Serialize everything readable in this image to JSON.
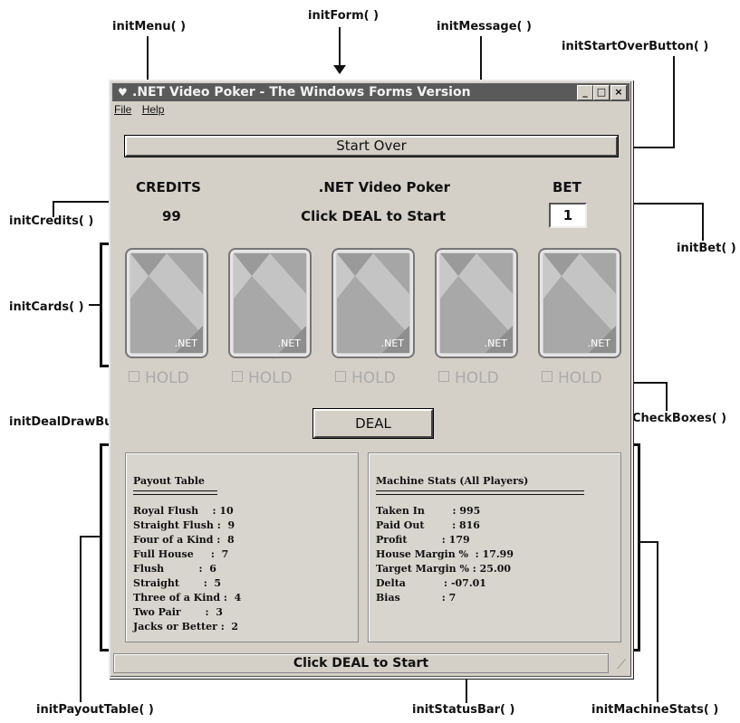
{
  "annotations": {
    "initMenu": "initMenu( )",
    "initForm": "initForm( )",
    "initMessage": "initMessage( )",
    "initStartOverButton": "initStartOverButton( )",
    "initCredits": "initCredits( )",
    "initBet": "initBet( )",
    "initCards": "initCards( )",
    "initHoldCheckBoxes": "initHoldCheckBoxes( )",
    "initDealDrawButton": "initDealDrawButton( )",
    "initPayoutTable": "initPayoutTable( )",
    "initStatusBar": "initStatusBar( )",
    "initMachineStats": "initMachineStats( )"
  },
  "window": {
    "title": ".NET Video Poker  -  The Windows Forms Version",
    "min": "_",
    "max": "□",
    "close": "×"
  },
  "menu": {
    "file": "File",
    "help": "Help"
  },
  "start_over": "Start Over",
  "credits": {
    "label": "CREDITS",
    "value": "99"
  },
  "message": {
    "title": ".NET Video Poker",
    "text": "Click DEAL to Start"
  },
  "bet": {
    "label": "BET",
    "value": "1"
  },
  "card_logo": ".NET",
  "hold_label": "HOLD",
  "deal_button": "DEAL",
  "payout": {
    "title": "Payout Table",
    "rows": [
      "Royal Flush    : 10",
      "Straight Flush :  9",
      "Four of a Kind :  8",
      "Full House     :  7",
      "Flush          :  6",
      "Straight       :  5",
      "Three of a Kind :  4",
      "Two Pair       :  3",
      "Jacks or Better :  2"
    ]
  },
  "stats": {
    "title": "Machine Stats (All Players)",
    "rows": [
      "Taken In        : 995",
      "Paid Out        : 816",
      "Profit          : 179",
      "House Margin %  : 17.99",
      "Target Margin % : 25.00",
      "Delta           : -07.01",
      "Bias            : 7"
    ]
  },
  "status_bar": "Click DEAL to Start"
}
